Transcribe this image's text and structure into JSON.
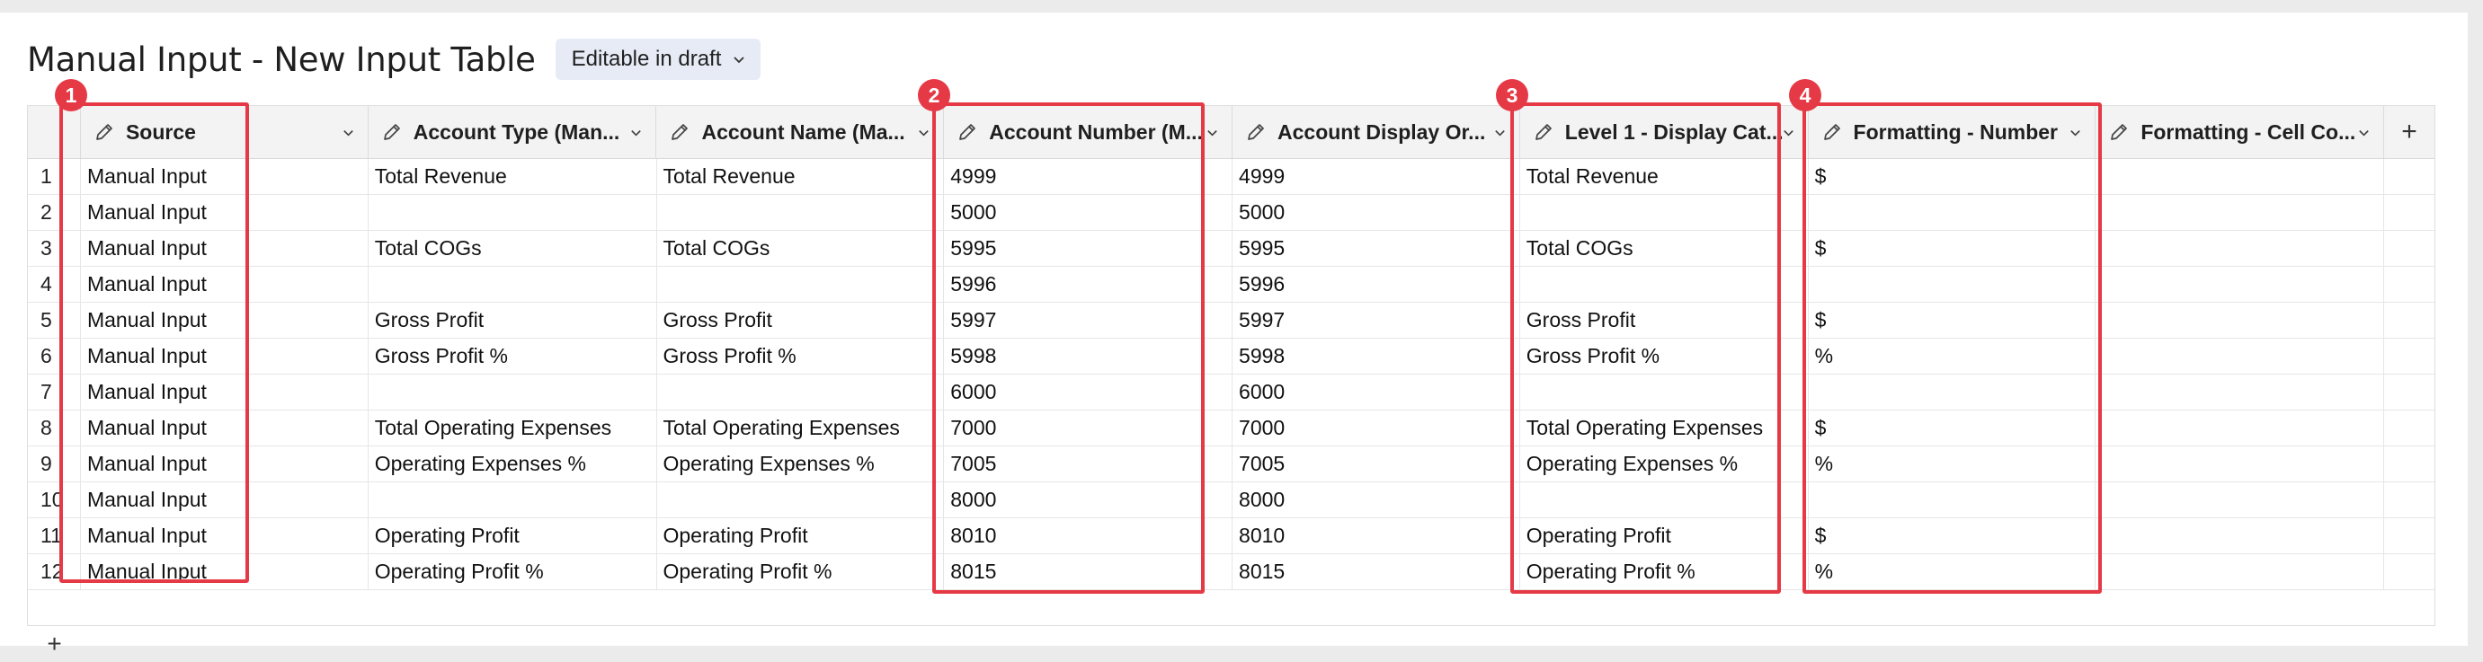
{
  "title": "Manual Input - New Input Table",
  "badge": "Editable in draft",
  "columns": [
    "Source",
    "Account Type (Man...",
    "Account Name (Ma...",
    "Account Number (M...",
    "Account Display Or...",
    "Level 1 - Display Cat...",
    "Formatting - Number",
    "Formatting - Cell Co..."
  ],
  "add_column_label": "+",
  "add_row_label": "+",
  "rows": [
    {
      "n": "1",
      "c": [
        "Manual Input",
        "Total Revenue",
        "Total Revenue",
        "4999",
        "4999",
        "Total Revenue",
        "$",
        ""
      ]
    },
    {
      "n": "2",
      "c": [
        "Manual Input",
        "",
        "",
        "5000",
        "5000",
        "",
        "",
        ""
      ]
    },
    {
      "n": "3",
      "c": [
        "Manual Input",
        "Total COGs",
        "Total COGs",
        "5995",
        "5995",
        "Total COGs",
        "$",
        ""
      ]
    },
    {
      "n": "4",
      "c": [
        "Manual Input",
        "",
        "",
        "5996",
        "5996",
        "",
        "",
        ""
      ]
    },
    {
      "n": "5",
      "c": [
        "Manual Input",
        "Gross Profit",
        "Gross Profit",
        "5997",
        "5997",
        "Gross Profit",
        "$",
        ""
      ]
    },
    {
      "n": "6",
      "c": [
        "Manual Input",
        "Gross Profit %",
        "Gross Profit %",
        "5998",
        "5998",
        "Gross Profit %",
        "%",
        ""
      ]
    },
    {
      "n": "7",
      "c": [
        "Manual Input",
        "",
        "",
        "6000",
        "6000",
        "",
        "",
        ""
      ]
    },
    {
      "n": "8",
      "c": [
        "Manual Input",
        "Total Operating Expenses",
        "Total Operating Expenses",
        "7000",
        "7000",
        "Total Operating Expenses",
        "$",
        ""
      ]
    },
    {
      "n": "9",
      "c": [
        "Manual Input",
        "Operating Expenses %",
        "Operating Expenses %",
        "7005",
        "7005",
        "Operating Expenses %",
        "%",
        ""
      ]
    },
    {
      "n": "10",
      "c": [
        "Manual Input",
        "",
        "",
        "8000",
        "8000",
        "",
        "",
        ""
      ]
    },
    {
      "n": "11",
      "c": [
        "Manual Input",
        "Operating Profit",
        "Operating Profit",
        "8010",
        "8010",
        "Operating Profit",
        "$",
        ""
      ]
    },
    {
      "n": "12",
      "c": [
        "Manual Input",
        "Operating Profit %",
        "Operating Profit %",
        "8015",
        "8015",
        "Operating Profit %",
        "%",
        ""
      ]
    }
  ],
  "markers": [
    "1",
    "2",
    "3",
    "4"
  ],
  "colors": {
    "highlight": "#e63946",
    "badge_bg": "#e6ebf5",
    "header_bg": "#f3f3f3"
  },
  "icons": {
    "column_edit": "pencil-icon",
    "column_menu": "chevron-down-icon",
    "badge_menu": "chevron-down-icon"
  }
}
